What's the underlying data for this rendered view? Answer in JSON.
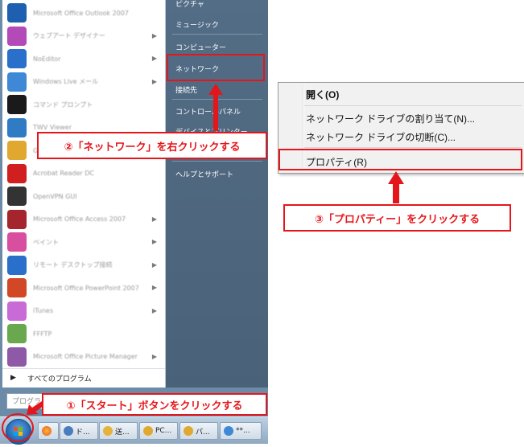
{
  "start_menu": {
    "programs": [
      {
        "label": "Microsoft Office Outlook 2007",
        "color": "#1f5fb0",
        "arrow": false
      },
      {
        "label": "ウェブアート デザイナー",
        "color": "#b24ab8",
        "arrow": true
      },
      {
        "label": "NoEditor",
        "color": "#2a6fc9",
        "arrow": true
      },
      {
        "label": "Windows Live メール",
        "color": "#3f88d6",
        "arrow": true
      },
      {
        "label": "コマンド プロンプト",
        "color": "#1a1a1a",
        "arrow": false
      },
      {
        "label": "TWV Viewer",
        "color": "#2f7bc4",
        "arrow": false
      },
      {
        "label": "Google Chrome",
        "color": "#e0a82e",
        "arrow": false
      },
      {
        "label": "Acrobat Reader DC",
        "color": "#d11f1f",
        "arrow": false
      },
      {
        "label": "OpenVPN GUI",
        "color": "#333333",
        "arrow": false
      },
      {
        "label": "Microsoft Office Access 2007",
        "color": "#a4262c",
        "arrow": true
      },
      {
        "label": "ペイント",
        "color": "#d94fa0",
        "arrow": true
      },
      {
        "label": "リモート デスクトップ接続",
        "color": "#2a6fc9",
        "arrow": true
      },
      {
        "label": "Microsoft Office PowerPoint 2007",
        "color": "#d24726",
        "arrow": true
      },
      {
        "label": "iTunes",
        "color": "#c96bd6",
        "arrow": true
      },
      {
        "label": "FFFTP",
        "color": "#6aa84f",
        "arrow": false
      },
      {
        "label": "Microsoft Office Picture Manager",
        "color": "#8e5aa8",
        "arrow": true
      }
    ],
    "all_programs": "すべてのプログラム",
    "search_placeholder": "プログラ",
    "right_items": {
      "pictures": "ピクチャ",
      "music": "ミュージック",
      "computer": "コンピューター",
      "network": "ネットワーク",
      "connect_to": "接続先",
      "control_panel": "コントロールパネル",
      "devices": "デバイスとプリンター",
      "help": "ヘルプとサポート"
    }
  },
  "taskbar": {
    "buttons": [
      {
        "label": "ド...",
        "color": "#4a7cc0"
      },
      {
        "label": "送...",
        "color": "#e6b23a"
      },
      {
        "label": "PC...",
        "color": "#e0a82e"
      },
      {
        "label": "パ...",
        "color": "#e0a82e"
      },
      {
        "label": "**...",
        "color": "#3f88d6"
      }
    ]
  },
  "context_menu": {
    "open": "開く(O)",
    "map_drive": "ネットワーク ドライブの割り当て(N)...",
    "disconnect_drive": "ネットワーク ドライブの切断(C)...",
    "properties": "プロパティ(R)"
  },
  "annotations": {
    "step1": "①「スタート」ボタンをクリックする",
    "step2": "②「ネットワーク」を右クリックする",
    "step3": "③「プロパティー」をクリックする",
    "accent_color": "#e5161b"
  }
}
